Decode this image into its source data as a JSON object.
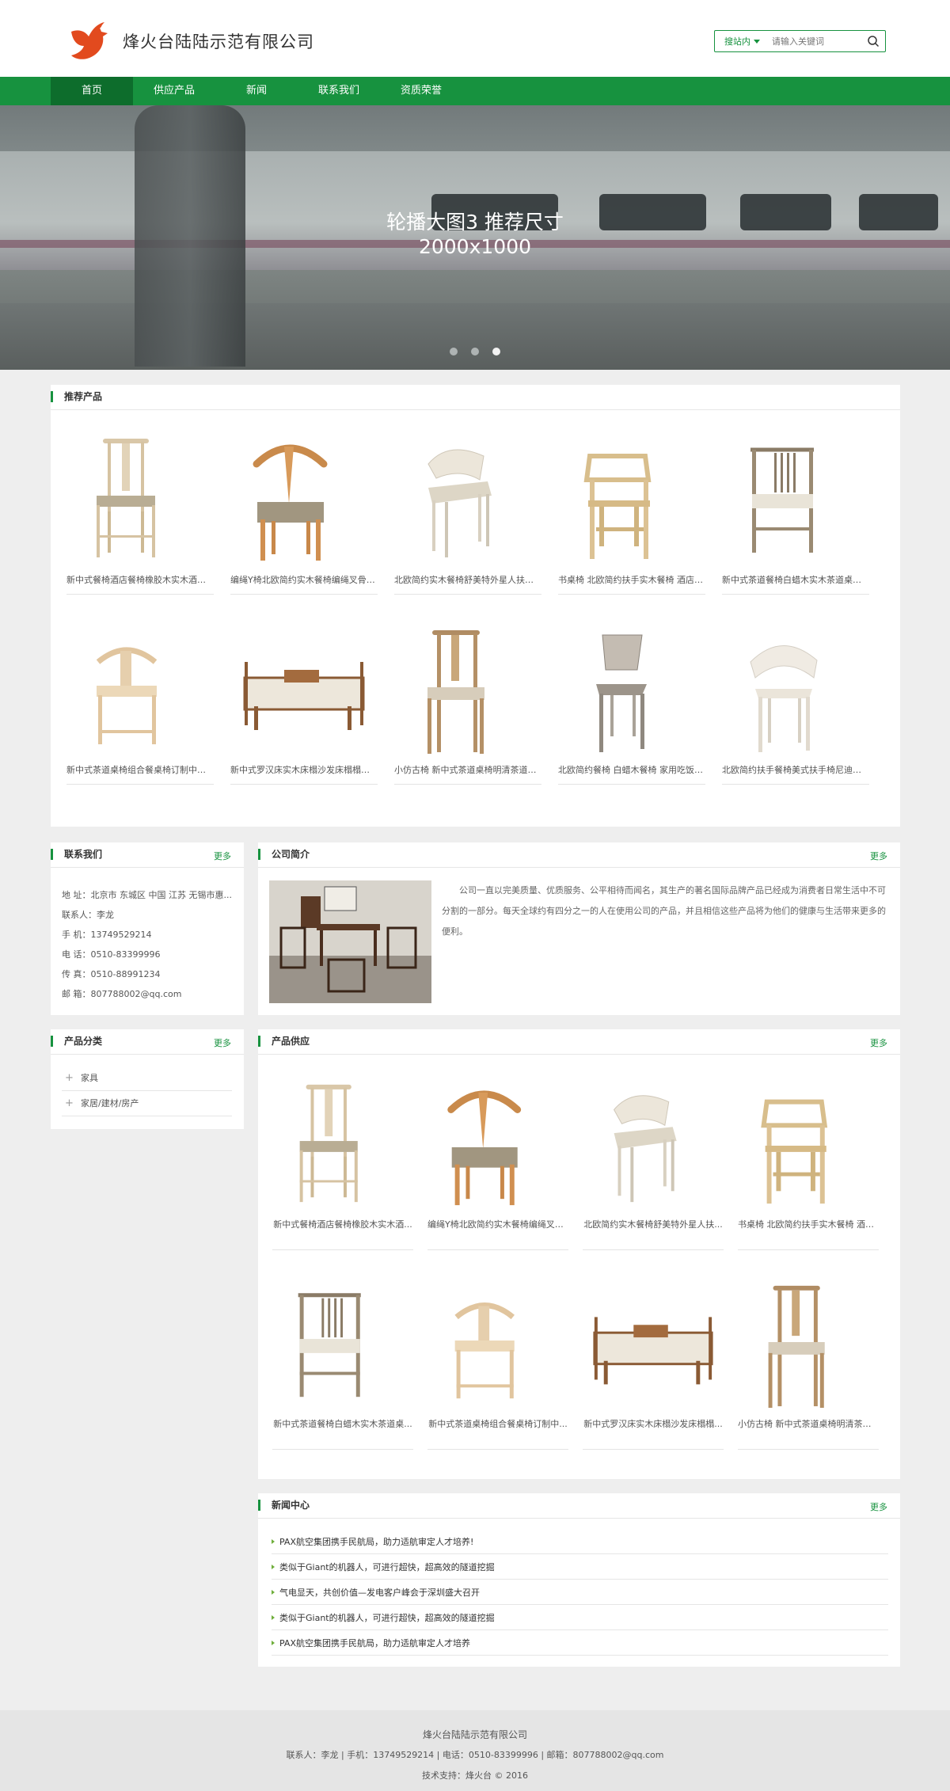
{
  "header": {
    "company_name": "烽火台陆陆示范有限公司",
    "search_scope": "搜站内",
    "search_placeholder": "请输入关键词"
  },
  "nav": {
    "items": [
      "首页",
      "供应产品",
      "新闻",
      "联系我们",
      "资质荣誉"
    ],
    "active_index": 0
  },
  "banner": {
    "caption_line1": "轮播大图3  推荐尺寸",
    "caption_line2": "2000x1000",
    "slide_count": 3,
    "active_slide": 3
  },
  "recommended": {
    "title": "推荐产品",
    "products": [
      "新中式餐椅酒店餐椅橡胶木实木酒店饭...",
      "编绳Y椅北欧简约实木餐椅编绳叉骨汉...",
      "北欧简约实木餐椅舒美特外星人扶手太...",
      "书桌椅 北欧简约扶手实木餐椅 酒店椅 ...",
      "新中式茶道餐椅白蜡木实木茶道桌椅组...",
      "新中式茶道桌椅组合餐桌椅订制中式茶...",
      "新中式罗汉床实木床榻沙发床榻榻米床...",
      "小仿古椅 新中式茶道桌椅明清茶道仿...",
      "北欧简约餐椅 白蜡木餐椅 家用吃饭实...",
      "北欧简约扶手餐椅美式扶手椅尼迪餐椅..."
    ]
  },
  "contact": {
    "title": "联系我们",
    "more": "更多",
    "lines": [
      "地 址：北京市 东城区 中国 江苏 无锡市惠...",
      "联系人：李龙",
      "手 机：13749529214",
      "电 话：0510-83399996",
      "传 真：0510-88991234",
      "邮 箱：807788002@qq.com"
    ]
  },
  "intro": {
    "title": "公司简介",
    "more": "更多",
    "text": "公司一直以完美质量、优质服务、公平相待而闻名，其生产的著名国际品牌产品已经成为消费者日常生活中不可分割的一部分。每天全球约有四分之一的人在使用公司的产品，并且相信这些产品将为他们的健康与生活带来更多的便利。"
  },
  "categories": {
    "title": "产品分类",
    "more": "更多",
    "items": [
      "家具",
      "家居/建材/房产"
    ]
  },
  "supply": {
    "title": "产品供应",
    "more": "更多",
    "products": [
      "新中式餐椅酒店餐椅橡胶木实木酒...",
      "编绳Y椅北欧简约实木餐椅编绳叉骨...",
      "北欧简约实木餐椅舒美特外星人扶...",
      "书桌椅 北欧简约扶手实木餐椅 酒店...",
      "新中式茶道餐椅白蜡木实木茶道桌...",
      "新中式茶道桌椅组合餐桌椅订制中...",
      "新中式罗汉床实木床榻沙发床榻榻...",
      "小仿古椅 新中式茶道桌椅明清茶道..."
    ]
  },
  "news": {
    "title": "新闻中心",
    "more": "更多",
    "items": [
      "PAX航空集团携手民航局，助力适航审定人才培养!",
      "类似于Giant的机器人，可进行超快，超高效的隧道挖掘",
      "气电显天，共创价值—发电客户峰会于深圳盛大召开",
      "类似于Giant的机器人，可进行超快，超高效的隧道挖掘",
      "PAX航空集团携手民航局，助力适航审定人才培养"
    ]
  },
  "footer": {
    "company": "烽火台陆陆示范有限公司",
    "contact_line": "联系人：李龙    |    手机：13749529214    |    电话：0510-83399996    |    邮箱：807788002@qq.com",
    "support": "技术支持：烽火台 © 2016"
  },
  "colors": {
    "brand_green": "#17923f",
    "nav_active": "#0d6d2c",
    "logo_red": "#e24a1e"
  }
}
